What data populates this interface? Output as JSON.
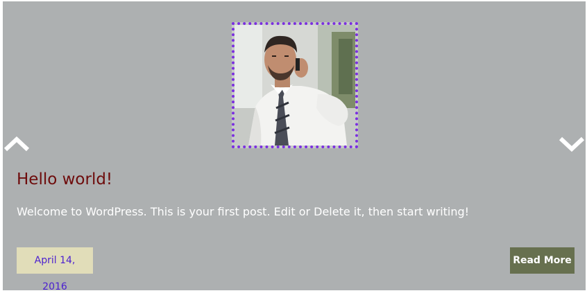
{
  "slider": {
    "prev_icon": "chevron-up-icon",
    "next_icon": "chevron-down-icon",
    "background_color": "#adb0b1"
  },
  "post": {
    "title": "Hello world!",
    "excerpt": "Welcome to WordPress. This is your first post. Edit or Delete it, then start writing!",
    "date": "April 14, 2016",
    "read_more_label": "Read More",
    "image_alt": "Man in white shirt and tie talking on a phone"
  },
  "colors": {
    "title": "#6e0c0c",
    "image_border": "#7b2fe0",
    "date_bg": "#e1ddb9",
    "date_text": "#4b1fd0",
    "button_bg": "#67704f"
  }
}
